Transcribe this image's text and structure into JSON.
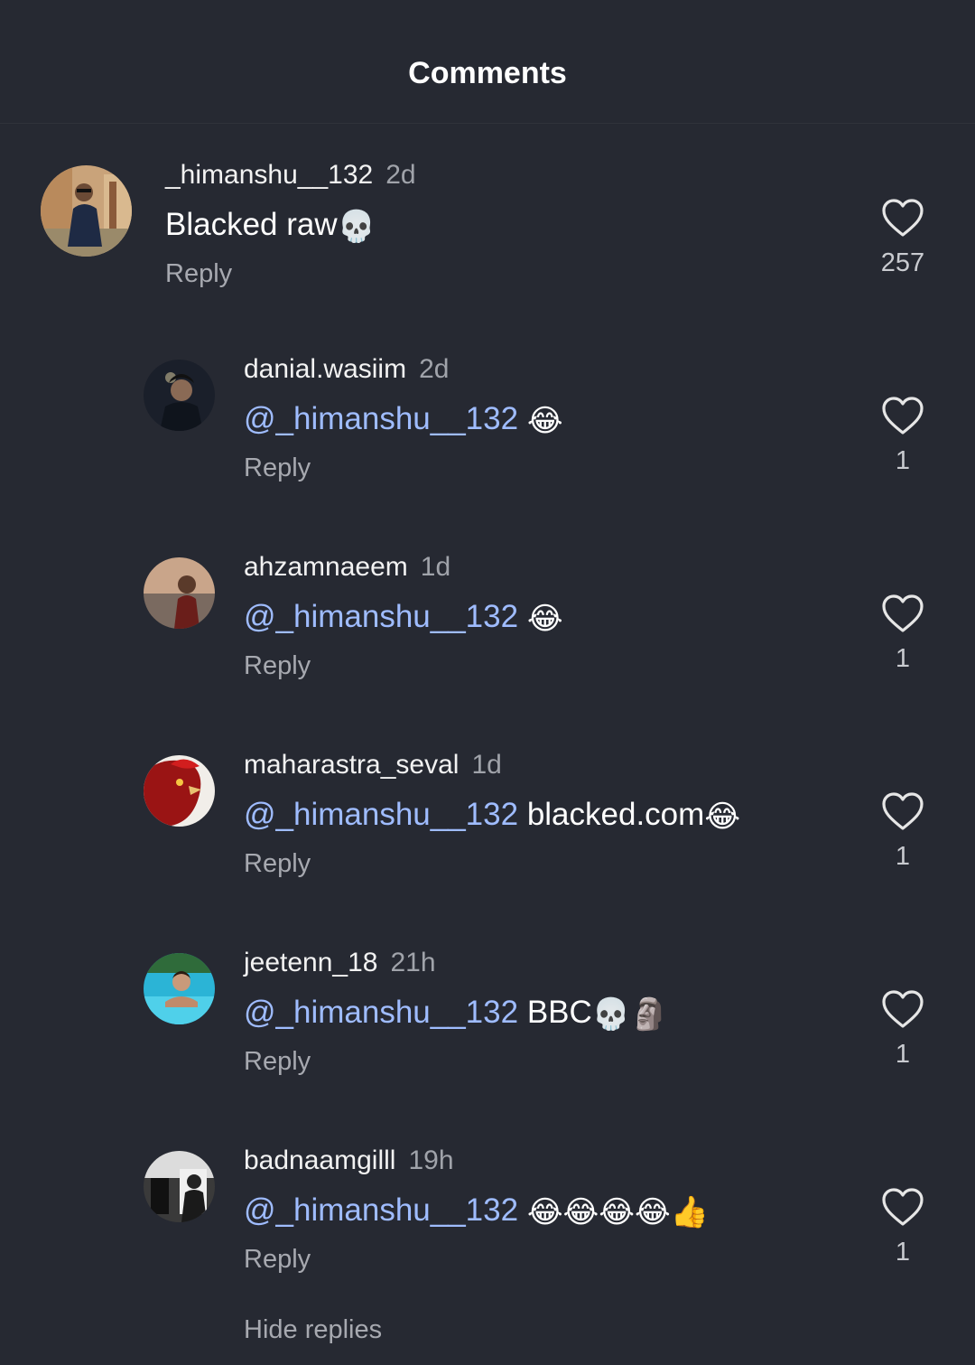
{
  "header": {
    "title": "Comments"
  },
  "comments": [
    {
      "username": "_himanshu__132",
      "time": "2d",
      "mention": "",
      "text": "Blacked raw",
      "emoji": "💀",
      "reply_label": "Reply",
      "likes": "257"
    },
    {
      "username": "danial.wasiim",
      "time": "2d",
      "mention": "@_himanshu__132",
      "text": " ",
      "emoji": "😂",
      "reply_label": "Reply",
      "likes": "1"
    },
    {
      "username": "ahzamnaeem",
      "time": "1d",
      "mention": "@_himanshu__132",
      "text": " ",
      "emoji": "😂",
      "reply_label": "Reply",
      "likes": "1"
    },
    {
      "username": "maharastra_seval",
      "time": "1d",
      "mention": "@_himanshu__132",
      "text": " blacked.com",
      "emoji": "😂",
      "reply_label": "Reply",
      "likes": "1"
    },
    {
      "username": "jeetenn_18",
      "time": "21h",
      "mention": "@_himanshu__132",
      "text": " BBC",
      "emoji": "💀🗿",
      "reply_label": "Reply",
      "likes": "1"
    },
    {
      "username": "badnaamgilll",
      "time": "19h",
      "mention": "@_himanshu__132",
      "text": " ",
      "emoji": "😂😂😂😂👍",
      "reply_label": "Reply",
      "likes": "1"
    }
  ],
  "footer": {
    "hide_replies_label": "Hide replies"
  },
  "colors": {
    "background": "#262932",
    "mention": "#9fbcff",
    "secondary_text": "#a7a9b0"
  },
  "icons": {
    "like": "heart-outline-icon"
  }
}
